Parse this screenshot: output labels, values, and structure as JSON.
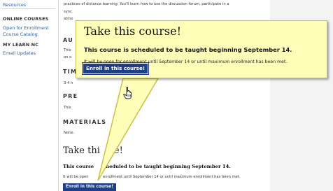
{
  "sidebar": {
    "link_top": "Resources",
    "online_courses_heading": "ONLINE COURSES",
    "open_enrollment": "Open for Enrollment",
    "course_catalog": "Course Catalog",
    "my_learn_heading": "MY LEARN NC",
    "email_updates": "Email Updates"
  },
  "content": {
    "intro_line1": "practices of distance learning. You'll learn how to use the discussion forum, participate in a",
    "intro_line2": "sync",
    "intro_line3": "atmo",
    "section_au": "AU",
    "au_line1": "This",
    "au_line2": "on o",
    "section_tim": "TIM",
    "tim_text": "3-4 h",
    "section_pre": "PRE",
    "pre_text": "This",
    "section_materials": "MATERIALS",
    "materials_text": "None.",
    "title_left": "Take thi",
    "title_right": "rse!",
    "schedule_left": "This course",
    "schedule_right": "cheduled to be taught beginning September 14.",
    "enroll_line_left": "It will be open",
    "enroll_line_right": "enrollment until September 14 or until maximum enrollment has been met.",
    "enroll_button_small": "Enroll in this course!"
  },
  "callout": {
    "title": "Take this course!",
    "schedule": "This course is scheduled to be taught beginning September 14.",
    "description": "It will be open for enrollment until September 14 or until maximum enrollment has been met.",
    "enroll_button": "Enroll in this course!"
  },
  "colors": {
    "callout_bg": "#ffffb9",
    "callout_border": "#c8c24a",
    "button_bg": "#1f3f86",
    "link": "#2a5fa8"
  }
}
